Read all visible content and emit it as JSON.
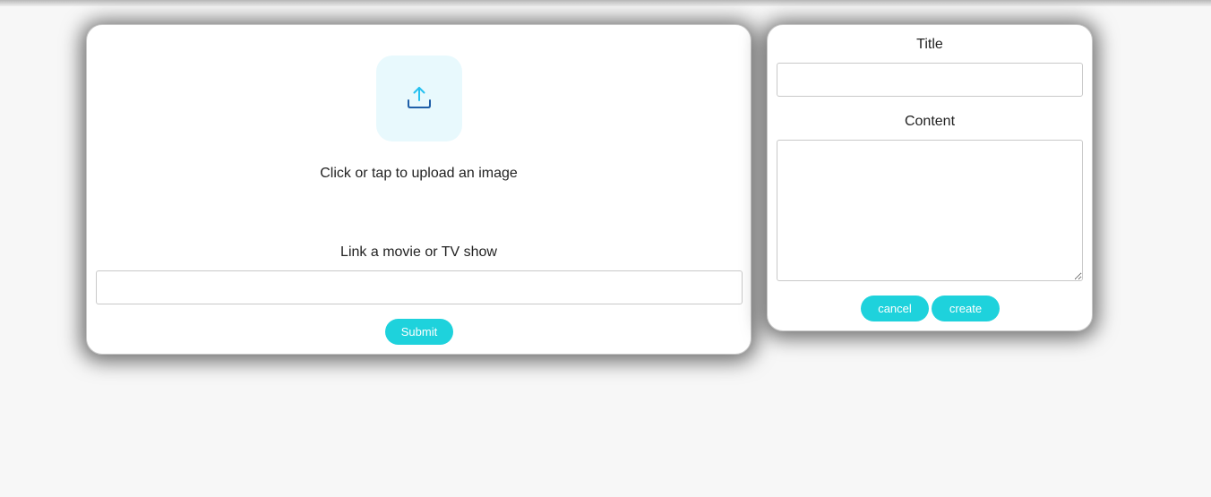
{
  "upload_panel": {
    "upload_prompt": "Click or tap to upload an image",
    "upload_icon": "upload-tray-arrow-icon",
    "link_label": "Link a movie or TV show",
    "link_value": "",
    "submit_label": "Submit"
  },
  "post_panel": {
    "title_label": "Title",
    "title_value": "",
    "content_label": "Content",
    "content_value": "",
    "cancel_label": "cancel",
    "create_label": "create"
  },
  "colors": {
    "accent": "#1ed2dc",
    "icon_arrow": "#25c1f0",
    "icon_tray": "#1f5fa8",
    "tile_bg": "#e8f9fd"
  }
}
